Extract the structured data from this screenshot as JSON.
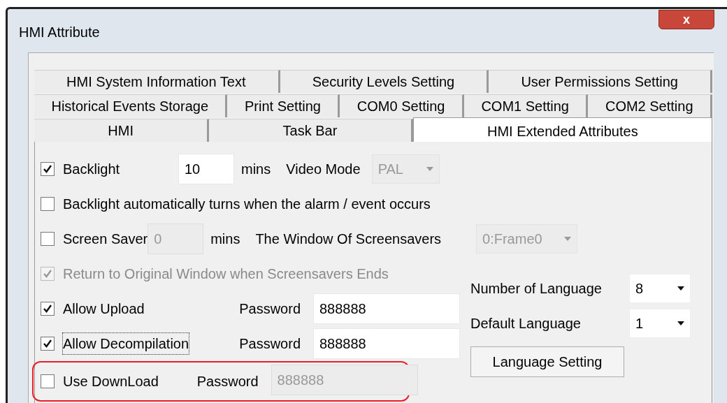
{
  "window": {
    "title": "HMI Attribute",
    "close": "x"
  },
  "tab_rows": [
    [
      {
        "label": "HMI System Information Text",
        "selected": false
      },
      {
        "label": "Security Levels Setting",
        "selected": false
      },
      {
        "label": "User Permissions Setting",
        "selected": false
      }
    ],
    [
      {
        "label": "Historical Events Storage",
        "selected": false
      },
      {
        "label": "Print Setting",
        "selected": false
      },
      {
        "label": "COM0 Setting",
        "selected": false
      },
      {
        "label": "COM1 Setting",
        "selected": false
      },
      {
        "label": "COM2 Setting",
        "selected": false
      }
    ],
    [
      {
        "label": "HMI",
        "selected": false
      },
      {
        "label": "Task Bar",
        "selected": false
      },
      {
        "label": "HMI Extended Attributes",
        "selected": true
      }
    ]
  ],
  "backlight": {
    "label": "Backlight",
    "checked": true,
    "minutes": "10",
    "minutes_disabled": false,
    "unit": "mins"
  },
  "video_mode": {
    "label": "Video Mode",
    "value": "PAL",
    "disabled": true
  },
  "alarm_backlight": {
    "label": "Backlight automatically turns when the alarm / event occurs",
    "checked": false
  },
  "screen_saver": {
    "label": "Screen Saver",
    "checked": false,
    "minutes": "0",
    "minutes_disabled": true,
    "unit": "mins"
  },
  "screensaver_window": {
    "label": "The Window Of Screensavers",
    "value": "0:Frame0",
    "disabled": true
  },
  "return_to_original": {
    "label": "Return to Original Window when Screensavers Ends",
    "checked": true,
    "disabled": true
  },
  "allow_upload": {
    "label": "Allow Upload",
    "checked": true,
    "focused": false,
    "password_label": "Password",
    "password": "888888",
    "password_disabled": false,
    "highlighted": false
  },
  "allow_decompilation": {
    "label": "Allow Decompilation",
    "checked": true,
    "focused": true,
    "password_label": "Password",
    "password": "888888",
    "password_disabled": false,
    "highlighted": false
  },
  "use_download": {
    "label": "Use DownLoad",
    "checked": false,
    "focused": false,
    "password_label": "Password",
    "password": "888888",
    "password_disabled": true,
    "highlighted": true
  },
  "number_of_language": {
    "label": "Number of Language",
    "value": "8",
    "disabled": false
  },
  "default_language": {
    "label": "Default Language",
    "value": "1",
    "disabled": false
  },
  "language_setting_button": "Language Setting"
}
